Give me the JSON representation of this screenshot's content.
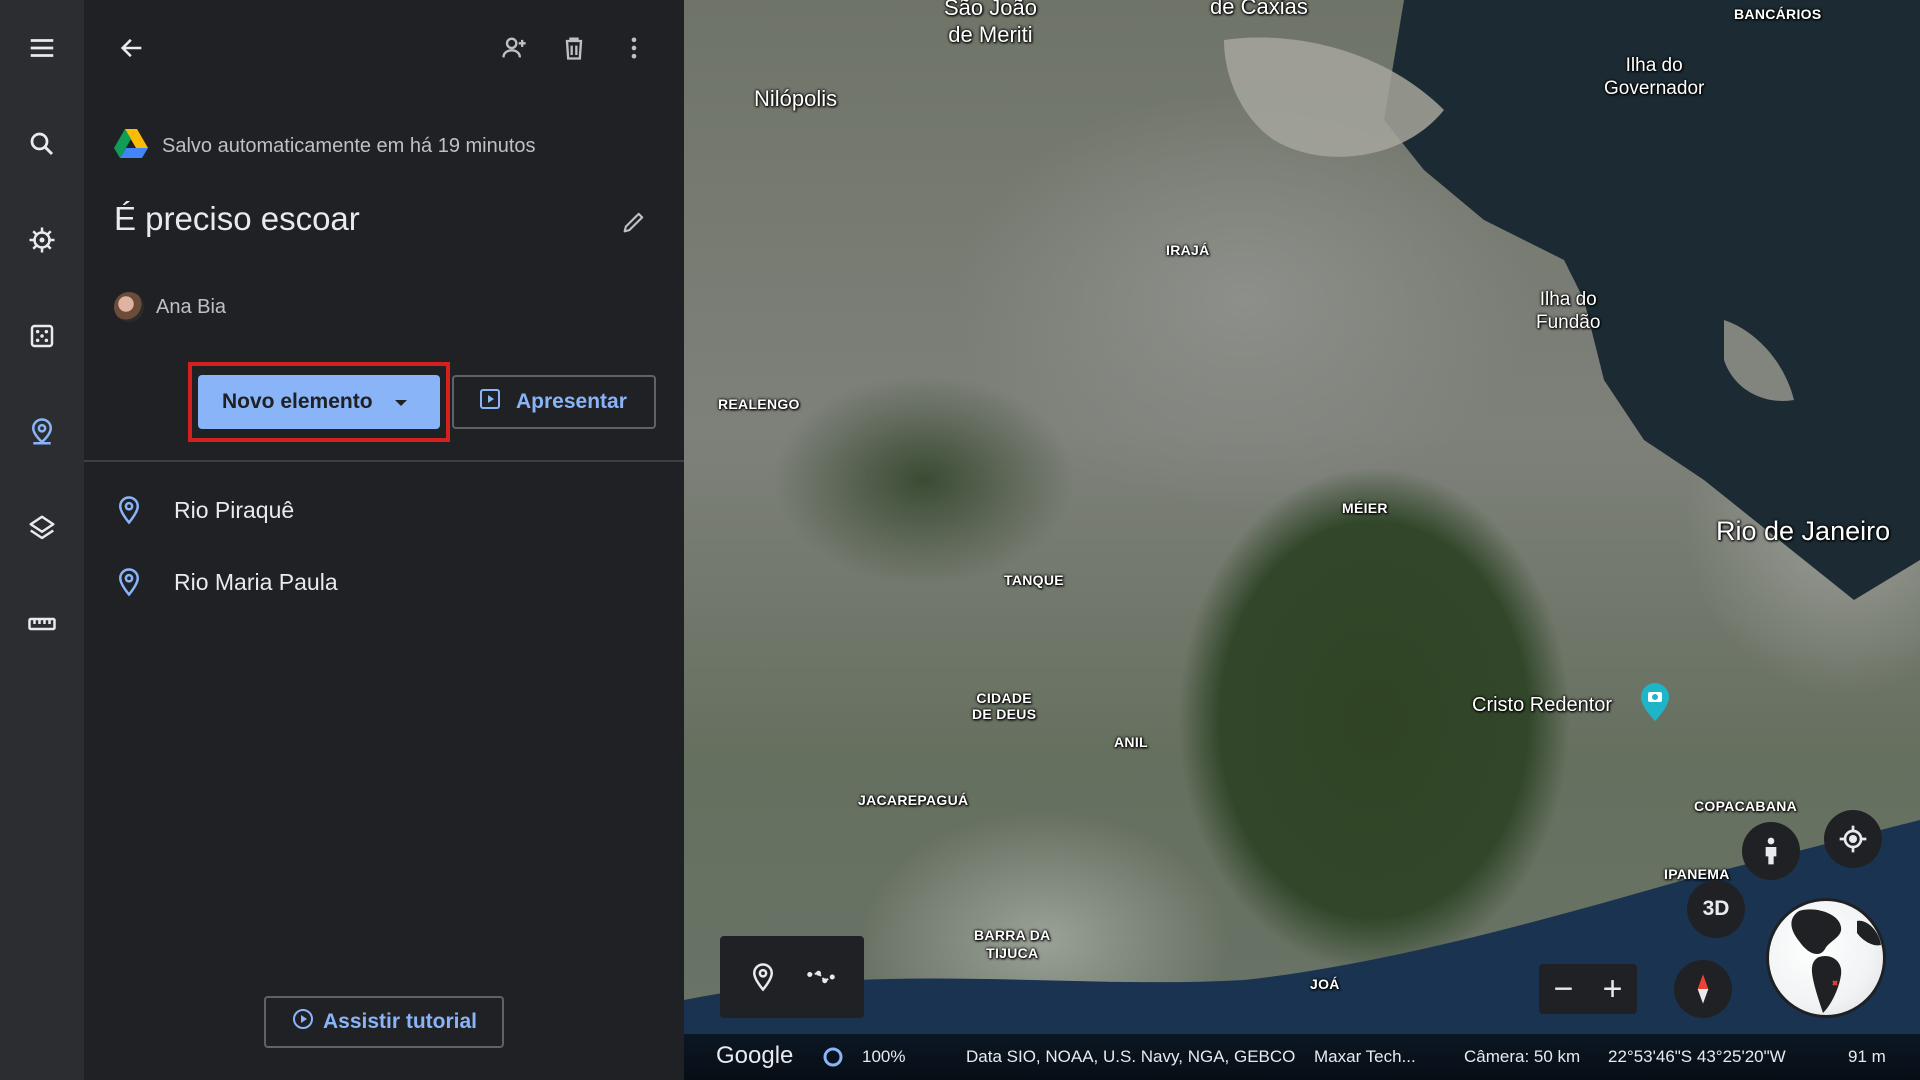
{
  "panel": {
    "saved_text": "Salvo automaticamente em há 19 minutos",
    "project_title": "É preciso escoar",
    "owner_name": "Ana Bia",
    "new_element_label": "Novo elemento",
    "present_label": "Apresentar",
    "tutorial_label": "Assistir tutorial",
    "items": [
      {
        "label": "Rio Piraquê"
      },
      {
        "label": "Rio Maria Paula"
      }
    ]
  },
  "rail": {
    "icons": [
      "menu-icon",
      "search-icon",
      "voyager-icon",
      "dice-icon",
      "projects-icon",
      "layers-icon",
      "ruler-icon"
    ]
  },
  "map": {
    "labels": {
      "sao_joao": "São João\nde Meriti",
      "caxias": "de Caxias",
      "bancarios": "BANCÁRIOS",
      "nilopolis": "Nilópolis",
      "ilha_governador": "Ilha do\nGovernador",
      "iraja": "IRAJÁ",
      "ilha_fundao": "Ilha do\nFundão",
      "realengo": "REALENGO",
      "meier": "MÉIER",
      "rio": "Rio de Janeiro",
      "tanque": "TANQUE",
      "cidade_deus": "CIDADE\nDE DEUS",
      "cristo": "Cristo Redentor",
      "anil": "ANIL",
      "jacarepagua": "JACAREPAGUÁ",
      "copacabana": "COPACABANA",
      "ipanema": "IPANEMA",
      "barra": "BARRA DA\nTIJUCA",
      "joa": "JOÁ"
    },
    "view_mode": "3D"
  },
  "status_bar": {
    "brand": "Google",
    "load_progress": "100%",
    "data_credits": "Data SIO, NOAA, U.S. Navy, NGA, GEBCO",
    "imagery_credits": "Maxar Tech...",
    "camera": "Câmera: 50 km",
    "coordinates": "22°53'46\"S 43°25'20\"W",
    "altitude": "91 m"
  },
  "colors": {
    "accent": "#8ab4f8",
    "highlight": "#d52020",
    "panel_bg": "#202124",
    "rail_bg": "#2c2d30"
  }
}
